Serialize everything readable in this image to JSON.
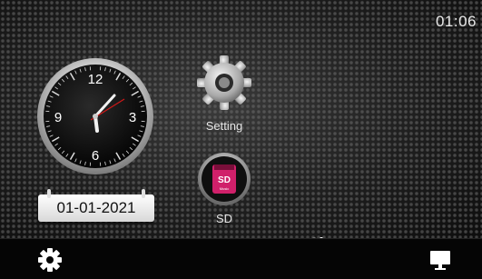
{
  "status": {
    "time": "01:06"
  },
  "clock_widget": {
    "numerals": [
      "12",
      "3",
      "6",
      "9"
    ],
    "date": "01-01-2021"
  },
  "apps": [
    {
      "label": "Setting",
      "icon": "gear-icon"
    },
    {
      "label": "SD",
      "icon": "sd-card-icon",
      "card_text": "SD",
      "card_subtext": "Music"
    }
  ],
  "pager": {
    "pages": 2,
    "active_index": 1
  },
  "bottom_bar": {
    "left_icon": "gear-icon",
    "right_icon": "monitor-icon"
  },
  "colors": {
    "accent_red": "#d01818",
    "sd_pink": "#d0206a"
  }
}
